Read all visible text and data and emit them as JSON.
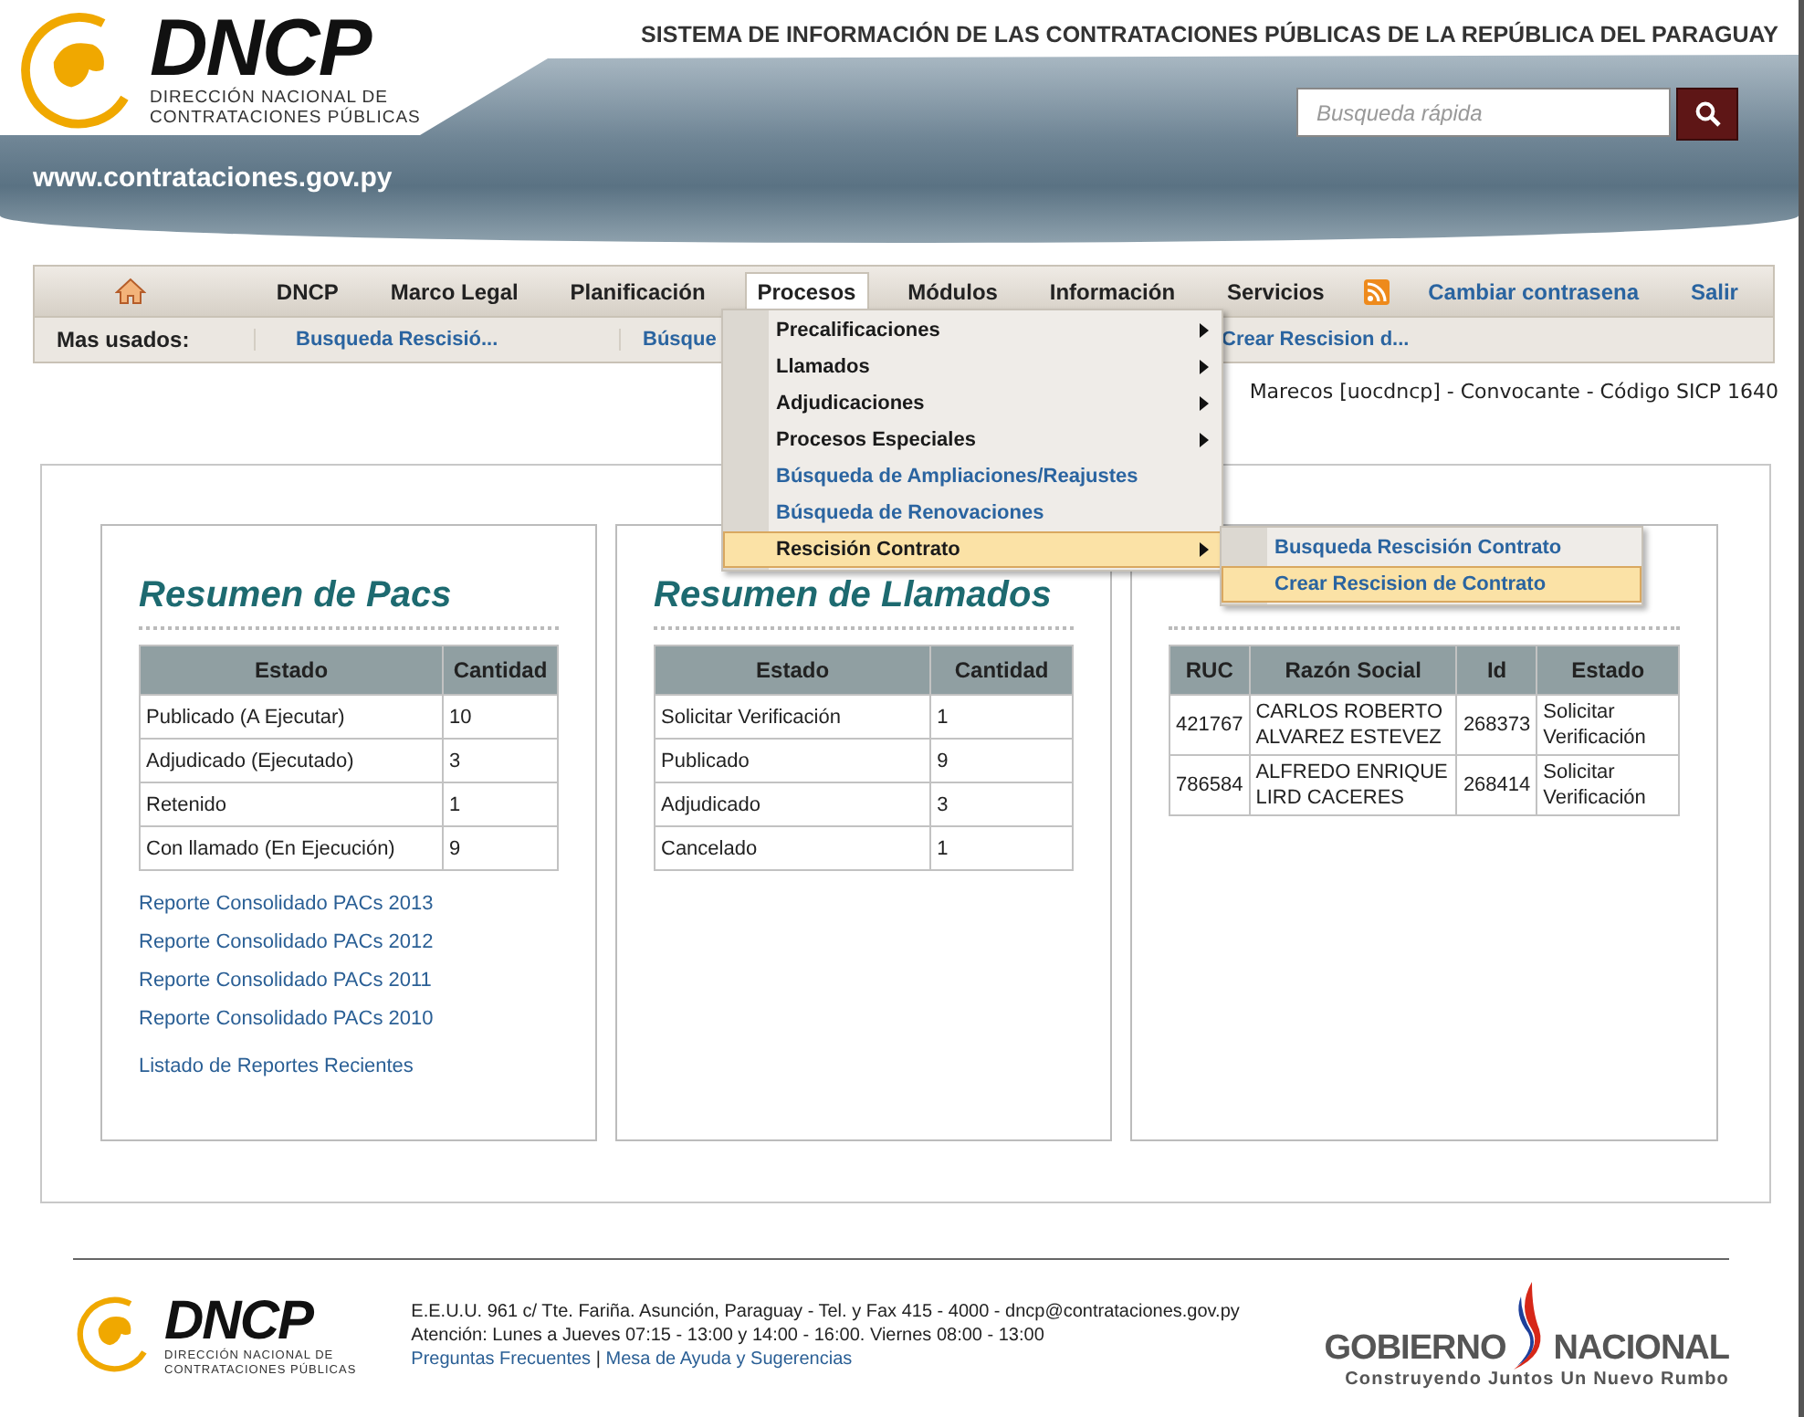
{
  "header": {
    "logo": {
      "acronym": "DNCP",
      "name_lines": [
        "DIRECCIÓN NACIONAL DE",
        "CONTRATACIONES PÚBLICAS"
      ]
    },
    "system_title": "SISTEMA DE INFORMACIÓN DE LAS CONTRATACIONES PÚBLICAS DE LA REPÚBLICA DEL PARAGUAY",
    "url": "www.contrataciones.gov.py",
    "search": {
      "placeholder": "Busqueda rápida"
    }
  },
  "nav": {
    "items": [
      {
        "kind": "home",
        "selected": false
      },
      {
        "kind": "menu",
        "label": "DNCP",
        "selected": false
      },
      {
        "kind": "menu",
        "label": "Marco Legal",
        "selected": false
      },
      {
        "kind": "menu",
        "label": "Planificación",
        "selected": false
      },
      {
        "kind": "menu",
        "label": "Procesos",
        "selected": true
      },
      {
        "kind": "menu",
        "label": "Módulos",
        "selected": false
      },
      {
        "kind": "menu",
        "label": "Información",
        "selected": false
      },
      {
        "kind": "menu",
        "label": "Servicios",
        "selected": false
      },
      {
        "kind": "feed",
        "selected": false
      },
      {
        "kind": "link",
        "label": "Cambiar contrasena",
        "selected": false
      },
      {
        "kind": "link",
        "label": "Salir",
        "selected": false
      }
    ]
  },
  "quick_bar": {
    "label": "Mas usados:",
    "links": [
      "Busqueda Rescisió...",
      "Búsque",
      "Crear Rescision d..."
    ]
  },
  "menu": {
    "items": [
      {
        "kind": "submenu",
        "label": "Precalificaciones",
        "selected": false
      },
      {
        "kind": "submenu",
        "label": "Llamados",
        "selected": false
      },
      {
        "kind": "submenu",
        "label": "Adjudicaciones",
        "selected": false
      },
      {
        "kind": "submenu",
        "label": "Procesos Especiales",
        "selected": false
      },
      {
        "kind": "link",
        "label": "Búsqueda de Ampliaciones/Reajustes",
        "selected": false
      },
      {
        "kind": "link",
        "label": "Búsqueda de Renovaciones",
        "selected": false
      },
      {
        "kind": "submenu",
        "label": "Rescisión Contrato",
        "selected": true
      }
    ]
  },
  "submenu": {
    "items": [
      {
        "label": "Busqueda Rescisión Contrato",
        "selected": false
      },
      {
        "label": "Crear Rescision de Contrato",
        "selected": true
      }
    ]
  },
  "user_info": "Marecos [uocdncp] - Convocante - Código SICP 1640",
  "panels": [
    {
      "title": "Resumen de Pacs",
      "table": {
        "columns": [
          "Estado",
          "Cantidad"
        ],
        "rows": [
          [
            "Publicado (A Ejecutar)",
            "10"
          ],
          [
            "Adjudicado (Ejecutado)",
            "3"
          ],
          [
            "Retenido",
            "1"
          ],
          [
            "Con llamado (En Ejecución)",
            "9"
          ]
        ]
      },
      "links": [
        "Reporte Consolidado PACs 2013",
        "Reporte Consolidado PACs 2012",
        "Reporte Consolidado PACs 2011",
        "Reporte Consolidado PACs 2010",
        "Listado de Reportes Recientes"
      ]
    },
    {
      "title": "Resumen de Llamados",
      "table": {
        "columns": [
          "Estado",
          "Cantidad"
        ],
        "rows": [
          [
            "Solicitar Verificación",
            "1"
          ],
          [
            "Publicado",
            "9"
          ],
          [
            "Adjudicado",
            "3"
          ],
          [
            "Cancelado",
            "1"
          ]
        ]
      }
    },
    {
      "table": {
        "columns": [
          "RUC",
          "Razón Social",
          "Id",
          "Estado"
        ],
        "rows": [
          [
            "421767",
            "CARLOS ROBERTO ALVAREZ ESTEVEZ",
            "268373",
            "Solicitar Verificación"
          ],
          [
            "786584",
            "ALFREDO ENRIQUE LIRD CACERES",
            "268414",
            "Solicitar Verificación"
          ]
        ]
      }
    }
  ],
  "footer": {
    "logo": {
      "acronym": "DNCP",
      "name_lines": [
        "DIRECCIÓN NACIONAL DE",
        "CONTRATACIONES PÚBLICAS"
      ]
    },
    "address_lines": [
      "E.E.U.U. 961 c/ Tte. Fariña. Asunción, Paraguay - Tel. y Fax 415 - 4000 - dncp@contrataciones.gov.py",
      "Atención: Lunes a Jueves 07:15 - 13:00 y 14:00 - 16:00. Viernes 08:00 - 13:00"
    ],
    "links": [
      "Preguntas Frecuentes",
      "Mesa de Ayuda y Sugerencias"
    ],
    "link_separator": "|",
    "gov_logo": {
      "words": [
        "GOBIERNO",
        "NACIONAL"
      ],
      "slogan": "Construyendo Juntos Un Nuevo Rumbo"
    }
  }
}
